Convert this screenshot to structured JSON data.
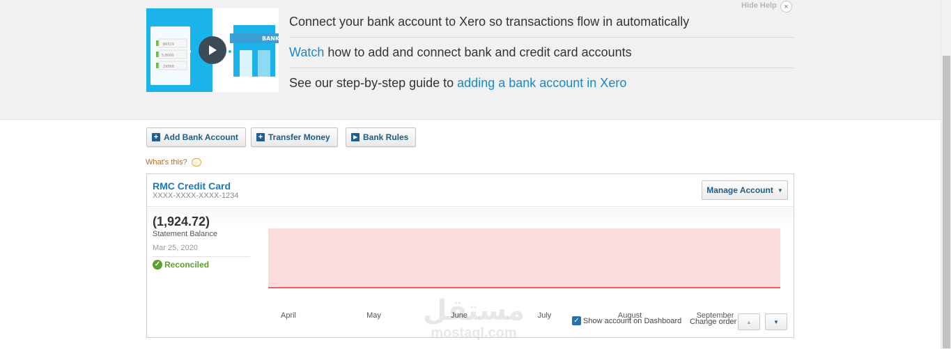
{
  "help": {
    "hide_help": "Hide Help",
    "close": "×",
    "line1": "Connect your bank account to Xero so transactions flow in automatically",
    "line2_link": "Watch",
    "line2_rest": " how to add and connect bank and credit card accounts",
    "line3_prefix": "See our step-by-step guide to ",
    "line3_link": "adding a bank account in Xero",
    "video_sign": "BANK",
    "video_amounts": [
      "86529",
      "5,8000",
      "29568"
    ]
  },
  "toolbar": {
    "add_bank_account": "Add Bank Account",
    "transfer_money": "Transfer Money",
    "bank_rules": "Bank Rules",
    "plus_icon": "+",
    "play_icon": "▸"
  },
  "whats_this": "What's this?",
  "account": {
    "name": "RMC Credit Card",
    "number": "XXXX-XXXX-XXXX-1234",
    "manage_label": "Manage Account",
    "caret": "▼",
    "balance": "(1,924.72)",
    "balance_label": "Statement Balance",
    "balance_date": "Mar 25, 2020",
    "status": "Reconciled",
    "status_icon": "✓",
    "show_on_dashboard": "Show account on Dashboard",
    "checkbox_mark": "✓",
    "change_order": "Change order",
    "up_arrow": "▲",
    "down_arrow": "▼"
  },
  "chart_data": {
    "type": "area",
    "categories": [
      "April",
      "May",
      "June",
      "July",
      "August",
      "September"
    ],
    "fill_color": "#fadcdc",
    "line_color": "#d13d3d",
    "grid": false
  },
  "watermark": {
    "arabic": "مستقل",
    "latin": "mostaql.com"
  }
}
